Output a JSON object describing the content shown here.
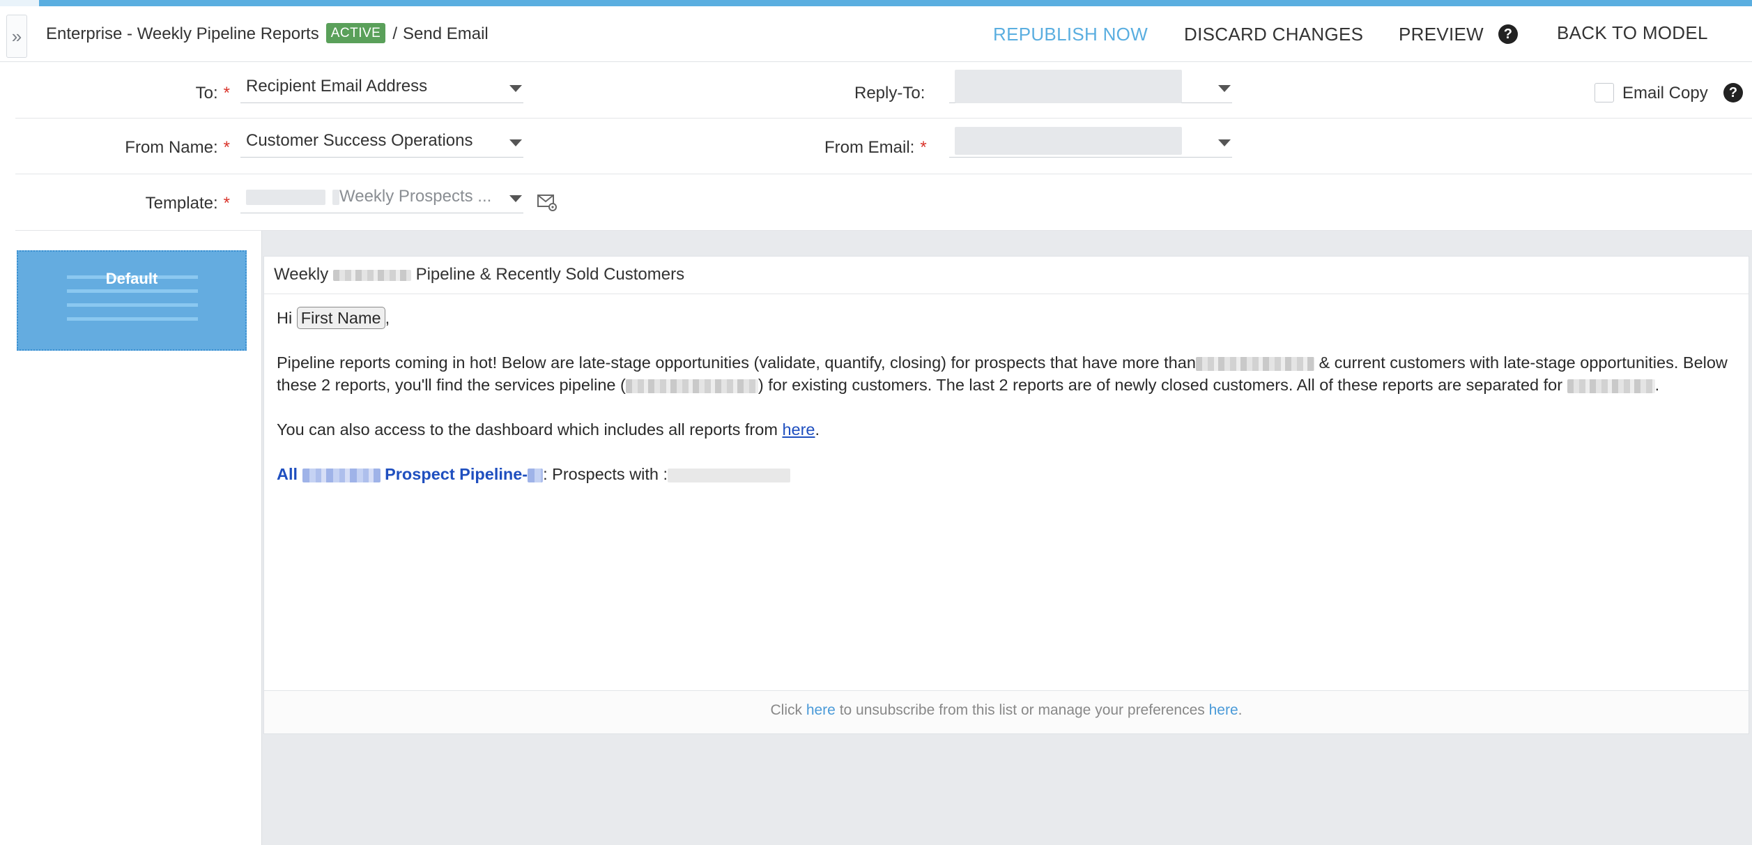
{
  "header": {
    "collapse_icon": "»",
    "program_name": "Enterprise - Weekly Pipeline Reports",
    "status_badge": "ACTIVE",
    "separator": "/",
    "page_name": "Send Email",
    "republish_label": "REPUBLISH NOW",
    "discard_label": "DISCARD CHANGES",
    "preview_label": "PREVIEW",
    "help_icon": "?",
    "back_label": "BACK TO MODEL",
    "accent_color": "#5aaee0"
  },
  "form": {
    "to": {
      "label": "To:",
      "required": "*",
      "value": "Recipient Email Address"
    },
    "reply_to": {
      "label": "Reply-To:",
      "value": ""
    },
    "email_copy": {
      "label": "Email Copy",
      "checked": false,
      "help_icon": "?"
    },
    "from_name": {
      "label": "From Name:",
      "required": "*",
      "value": "Customer Success Operations"
    },
    "from_email": {
      "label": "From Email:",
      "required": "*",
      "value": ""
    },
    "template": {
      "label": "Template:",
      "required": "*",
      "value": "Weekly Prospects ...",
      "settings_icon": "email-settings-icon"
    }
  },
  "variants": [
    {
      "label": "Default",
      "selected": true
    }
  ],
  "email": {
    "subject_prefix": "Weekly",
    "subject_suffix": "Pipeline & Recently Sold Customers",
    "greeting": "Hi",
    "first_name_token": "First Name",
    "greeting_end": ",",
    "para1_a": "Pipeline reports coming in hot! Below are late-stage opportunities (validate, quantify, closing) for prospects that have more than",
    "para1_b": "& current customers with late-stage opportunities. Below these 2 reports, you'll find the services pipeline (",
    "para1_c": ") for existing customers. The last 2 reports are of newly closed customers. All of these reports are separated for",
    "para1_d": ".",
    "para2_a": "You can also access to the dashboard which includes all reports from",
    "para2_link": "here",
    "para2_end": ".",
    "section_all": "All",
    "section_title": "Prospect Pipeline-",
    "section_rest": ": Prospects with :",
    "footer_click": "Click",
    "footer_here1": "here",
    "footer_mid": "to unsubscribe from this list or manage your preferences",
    "footer_here2": "here",
    "footer_end": "."
  }
}
